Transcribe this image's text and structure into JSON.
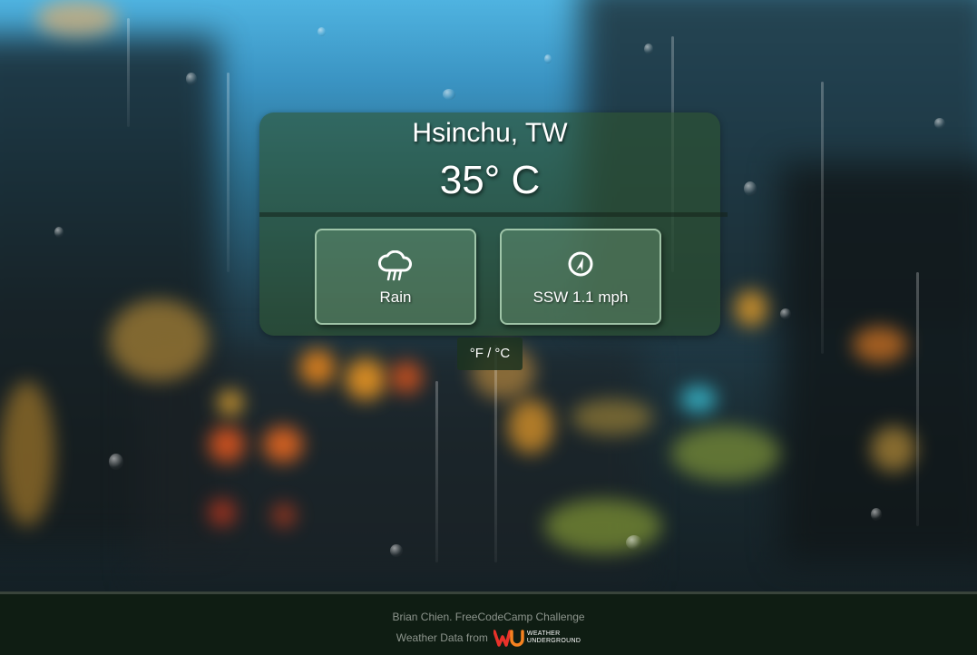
{
  "location": {
    "city": "Hsinchu, TW"
  },
  "temperature": {
    "display": "35° C"
  },
  "condition": {
    "icon": "rain-cloud-icon",
    "label": "Rain"
  },
  "wind": {
    "icon": "compass-icon",
    "label": "SSW 1.1 mph"
  },
  "unit_toggle": {
    "label": "°F / °C"
  },
  "footer": {
    "credit": "Brian Chien. FreeCodeCamp Challenge",
    "source_prefix": "Weather Data from",
    "logo_line1": "WEATHER",
    "logo_line2": "UNDERGROUND"
  },
  "colors": {
    "card": "#2f5532",
    "footer": "#0f1d13",
    "logo_red": "#e8322a",
    "logo_orange": "#f58220"
  }
}
